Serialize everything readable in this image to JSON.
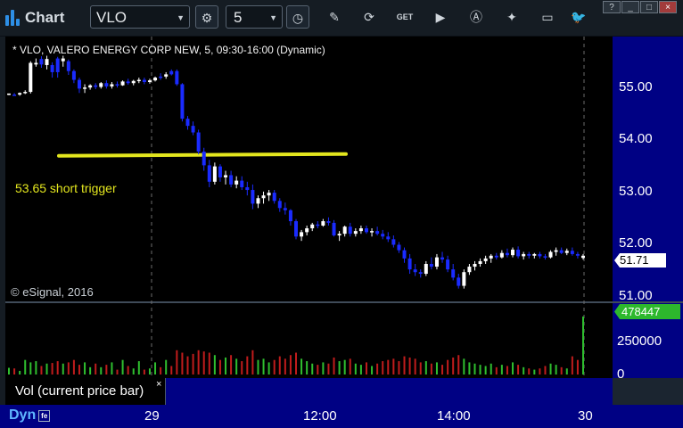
{
  "app": {
    "title": "Chart"
  },
  "toolbar": {
    "symbol": "VLO",
    "interval": "5",
    "icons": [
      "settings-gear-icon",
      "clock-icon",
      "pencil-icon",
      "refresh-icon",
      "get-icon",
      "play-icon",
      "alert-icon",
      "tools-icon",
      "chat-icon",
      "twitter-icon"
    ]
  },
  "window_controls": {
    "help": "?",
    "minimize": "_",
    "restore": "□",
    "close": "×"
  },
  "chart": {
    "header": "* VLO, VALERO ENERGY CORP NEW, 5, 09:30-16:00 (Dynamic)",
    "watermark": "© eSignal, 2016",
    "annotation_text": "53.65 short trigger",
    "last_price": "51.71",
    "last_volume": "478447"
  },
  "volume_panel": {
    "label": "Vol (current price bar)",
    "close": "×"
  },
  "footer": {
    "mode": "Dyn",
    "badge": "fe"
  },
  "colors": {
    "background": "#000000",
    "axis": "#000184",
    "up": "#ffffff",
    "down": "#1a2bff",
    "vol_up": "#2fbf2f",
    "vol_down": "#c01c1c",
    "annotation": "#e3e61e"
  },
  "chart_data": {
    "type": "candlestick",
    "title": "* VLO, VALERO ENERGY CORP NEW, 5, 09:30-16:00 (Dynamic)",
    "price_axis": {
      "ticks": [
        "55.00",
        "54.00",
        "53.00",
        "52.00",
        "51.00"
      ],
      "range": [
        50.9,
        55.75
      ]
    },
    "volume_axis": {
      "ticks": [
        "250000",
        "0"
      ],
      "range": [
        0,
        500000
      ]
    },
    "time_ticks": [
      "29",
      "12:00",
      "14:00",
      "30"
    ],
    "annotation": {
      "price": 53.59,
      "label": "53.65 short trigger"
    },
    "last_price": 51.71,
    "last_volume": 478447,
    "candles": [
      [
        54.71,
        54.71,
        54.68,
        54.69,
        55000,
        1
      ],
      [
        54.69,
        54.72,
        54.68,
        54.69,
        50000,
        0
      ],
      [
        54.69,
        54.73,
        54.67,
        54.72,
        30000,
        1
      ],
      [
        54.72,
        54.77,
        54.7,
        54.74,
        120000,
        1
      ],
      [
        54.74,
        55.3,
        54.71,
        55.27,
        100000,
        1
      ],
      [
        55.27,
        55.35,
        55.2,
        55.24,
        110000,
        1
      ],
      [
        55.24,
        55.39,
        55.18,
        55.34,
        70000,
        0
      ],
      [
        55.34,
        55.4,
        55.15,
        55.23,
        90000,
        1
      ],
      [
        55.23,
        55.28,
        55.0,
        55.1,
        95000,
        0
      ],
      [
        55.1,
        55.38,
        55.0,
        55.35,
        110000,
        0
      ],
      [
        55.35,
        55.4,
        55.2,
        55.3,
        90000,
        1
      ],
      [
        55.3,
        55.33,
        55.05,
        55.12,
        100000,
        0
      ],
      [
        55.12,
        55.15,
        54.9,
        54.96,
        120000,
        0
      ],
      [
        54.96,
        55.0,
        54.72,
        54.8,
        80000,
        0
      ],
      [
        54.8,
        54.88,
        54.72,
        54.82,
        100000,
        1
      ],
      [
        54.82,
        54.88,
        54.78,
        54.86,
        60000,
        1
      ],
      [
        54.86,
        54.9,
        54.79,
        54.83,
        90000,
        0
      ],
      [
        54.83,
        54.92,
        54.8,
        54.9,
        60000,
        1
      ],
      [
        54.9,
        54.95,
        54.8,
        54.84,
        80000,
        0
      ],
      [
        54.84,
        54.92,
        54.8,
        54.88,
        100000,
        1
      ],
      [
        54.88,
        54.93,
        54.82,
        54.86,
        40000,
        0
      ],
      [
        54.86,
        54.95,
        54.85,
        54.93,
        120000,
        1
      ],
      [
        54.93,
        54.98,
        54.87,
        54.9,
        70000,
        0
      ],
      [
        54.9,
        54.96,
        54.86,
        54.94,
        50000,
        1
      ],
      [
        54.94,
        55.0,
        54.9,
        54.96,
        110000,
        1
      ],
      [
        54.96,
        55.0,
        54.88,
        54.92,
        40000,
        0
      ],
      [
        54.92,
        54.98,
        54.89,
        54.95,
        50000,
        1
      ],
      [
        54.95,
        55.02,
        54.93,
        55.0,
        100000,
        1
      ],
      [
        55.0,
        55.08,
        54.96,
        55.02,
        60000,
        0
      ],
      [
        55.02,
        55.1,
        54.98,
        55.06,
        120000,
        1
      ],
      [
        55.06,
        55.15,
        55.04,
        55.12,
        70000,
        0
      ],
      [
        55.12,
        55.15,
        54.85,
        54.88,
        200000,
        0
      ],
      [
        54.88,
        54.9,
        54.2,
        54.25,
        180000,
        0
      ],
      [
        54.25,
        54.3,
        54.05,
        54.12,
        150000,
        0
      ],
      [
        54.12,
        54.2,
        53.95,
        54.0,
        170000,
        0
      ],
      [
        54.0,
        54.05,
        53.6,
        53.65,
        200000,
        0
      ],
      [
        53.65,
        53.72,
        53.3,
        53.4,
        190000,
        0
      ],
      [
        53.4,
        53.5,
        53.0,
        53.1,
        180000,
        0
      ],
      [
        53.1,
        53.45,
        53.05,
        53.38,
        160000,
        1
      ],
      [
        53.38,
        53.42,
        53.1,
        53.18,
        120000,
        0
      ],
      [
        53.18,
        53.3,
        53.05,
        53.22,
        140000,
        1
      ],
      [
        53.22,
        53.3,
        53.0,
        53.05,
        160000,
        0
      ],
      [
        53.05,
        53.2,
        52.98,
        53.12,
        130000,
        1
      ],
      [
        53.12,
        53.2,
        52.95,
        53.0,
        110000,
        0
      ],
      [
        53.0,
        53.1,
        52.85,
        52.95,
        150000,
        0
      ],
      [
        52.95,
        53.05,
        52.6,
        52.7,
        200000,
        0
      ],
      [
        52.7,
        52.85,
        52.62,
        52.8,
        120000,
        1
      ],
      [
        52.8,
        52.92,
        52.7,
        52.85,
        130000,
        1
      ],
      [
        52.85,
        52.95,
        52.75,
        52.9,
        100000,
        1
      ],
      [
        52.9,
        52.95,
        52.7,
        52.75,
        120000,
        0
      ],
      [
        52.75,
        52.8,
        52.55,
        52.62,
        150000,
        0
      ],
      [
        52.62,
        52.72,
        52.5,
        52.58,
        130000,
        0
      ],
      [
        52.58,
        52.6,
        52.3,
        52.38,
        160000,
        0
      ],
      [
        52.38,
        52.42,
        52.05,
        52.1,
        180000,
        0
      ],
      [
        52.1,
        52.22,
        52.02,
        52.18,
        130000,
        1
      ],
      [
        52.18,
        52.3,
        52.12,
        52.25,
        110000,
        1
      ],
      [
        52.25,
        52.35,
        52.2,
        52.32,
        90000,
        1
      ],
      [
        52.32,
        52.38,
        52.25,
        52.3,
        80000,
        0
      ],
      [
        52.3,
        52.42,
        52.28,
        52.38,
        100000,
        1
      ],
      [
        52.38,
        52.45,
        52.3,
        52.35,
        90000,
        0
      ],
      [
        52.35,
        52.4,
        52.1,
        52.12,
        140000,
        0
      ],
      [
        52.12,
        52.2,
        52.02,
        52.15,
        110000,
        1
      ],
      [
        52.15,
        52.3,
        52.1,
        52.28,
        120000,
        1
      ],
      [
        52.28,
        52.35,
        52.1,
        52.15,
        130000,
        0
      ],
      [
        52.15,
        52.25,
        52.1,
        52.2,
        90000,
        1
      ],
      [
        52.2,
        52.3,
        52.15,
        52.25,
        80000,
        1
      ],
      [
        52.25,
        52.3,
        52.15,
        52.18,
        100000,
        0
      ],
      [
        52.18,
        52.25,
        52.1,
        52.2,
        70000,
        1
      ],
      [
        52.2,
        52.28,
        52.12,
        52.15,
        90000,
        0
      ],
      [
        52.15,
        52.22,
        52.05,
        52.1,
        110000,
        0
      ],
      [
        52.1,
        52.18,
        52.0,
        52.05,
        120000,
        0
      ],
      [
        52.05,
        52.12,
        51.9,
        51.95,
        130000,
        0
      ],
      [
        51.95,
        52.0,
        51.8,
        51.85,
        110000,
        0
      ],
      [
        51.85,
        51.9,
        51.62,
        51.7,
        150000,
        0
      ],
      [
        51.7,
        51.78,
        51.42,
        51.5,
        140000,
        0
      ],
      [
        51.5,
        51.6,
        51.38,
        51.45,
        130000,
        0
      ],
      [
        51.45,
        51.5,
        51.35,
        51.42,
        100000,
        0
      ],
      [
        51.42,
        51.65,
        51.38,
        51.6,
        110000,
        1
      ],
      [
        51.6,
        51.72,
        51.5,
        51.55,
        90000,
        0
      ],
      [
        51.55,
        51.78,
        51.5,
        51.72,
        100000,
        1
      ],
      [
        51.72,
        51.82,
        51.62,
        51.68,
        80000,
        0
      ],
      [
        51.68,
        51.75,
        51.45,
        51.5,
        120000,
        0
      ],
      [
        51.5,
        51.6,
        51.3,
        51.35,
        140000,
        0
      ],
      [
        51.35,
        51.42,
        51.15,
        51.2,
        160000,
        0
      ],
      [
        51.2,
        51.5,
        51.15,
        51.45,
        130000,
        1
      ],
      [
        51.45,
        51.6,
        51.4,
        51.55,
        100000,
        1
      ],
      [
        51.55,
        51.65,
        51.48,
        51.6,
        90000,
        1
      ],
      [
        51.6,
        51.7,
        51.55,
        51.65,
        80000,
        1
      ],
      [
        51.65,
        51.75,
        51.6,
        51.7,
        70000,
        1
      ],
      [
        51.7,
        51.78,
        51.62,
        51.75,
        90000,
        1
      ],
      [
        51.75,
        51.8,
        51.68,
        51.72,
        60000,
        0
      ],
      [
        51.72,
        51.85,
        51.7,
        51.8,
        80000,
        1
      ],
      [
        51.8,
        51.88,
        51.72,
        51.76,
        70000,
        0
      ],
      [
        51.76,
        51.9,
        51.72,
        51.86,
        100000,
        1
      ],
      [
        51.86,
        51.92,
        51.7,
        51.74,
        80000,
        0
      ],
      [
        51.74,
        51.82,
        51.68,
        51.78,
        60000,
        1
      ],
      [
        51.78,
        51.82,
        51.7,
        51.75,
        50000,
        0
      ],
      [
        51.75,
        51.8,
        51.7,
        51.78,
        40000,
        1
      ],
      [
        51.78,
        51.82,
        51.7,
        51.74,
        50000,
        0
      ],
      [
        51.74,
        51.78,
        51.68,
        51.72,
        70000,
        0
      ],
      [
        51.72,
        51.85,
        51.7,
        51.82,
        90000,
        1
      ],
      [
        51.82,
        51.9,
        51.75,
        51.85,
        80000,
        1
      ],
      [
        51.85,
        51.9,
        51.78,
        51.8,
        60000,
        0
      ],
      [
        51.8,
        51.88,
        51.76,
        51.84,
        50000,
        1
      ],
      [
        51.84,
        51.9,
        51.75,
        51.78,
        150000,
        0
      ],
      [
        51.78,
        51.82,
        51.7,
        51.75,
        120000,
        0
      ],
      [
        51.75,
        51.78,
        51.68,
        51.71,
        478447,
        1
      ]
    ]
  }
}
